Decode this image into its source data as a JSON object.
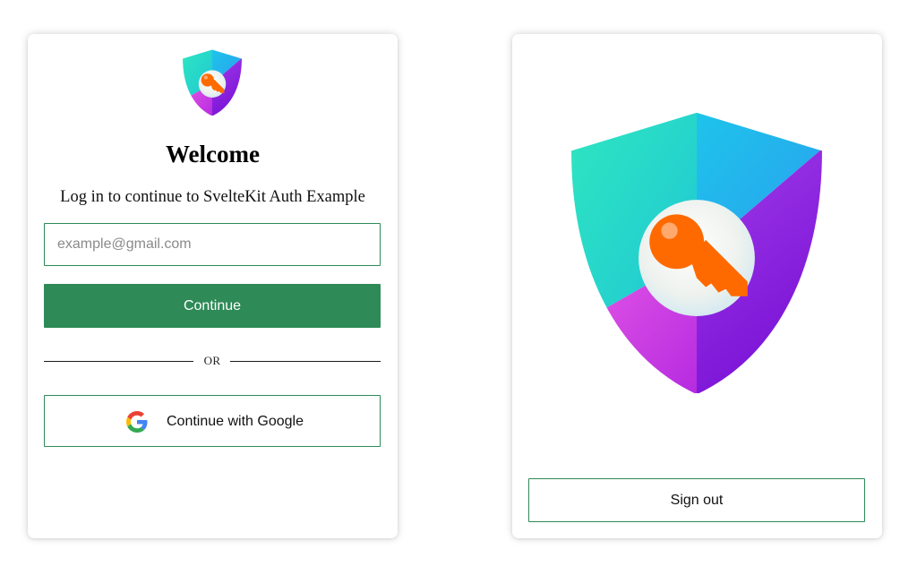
{
  "login": {
    "logo_icon": "shield-key-icon",
    "title": "Welcome",
    "subtitle": "Log in to continue to SvelteKit Auth Example",
    "email": {
      "value": "",
      "placeholder": "example@gmail.com"
    },
    "continue_label": "Continue",
    "divider_label": "OR",
    "google_icon": "google-icon",
    "google_label": "Continue with Google"
  },
  "session": {
    "logo_icon": "shield-key-icon",
    "signout_label": "Sign out"
  },
  "colors": {
    "accent": "#2e8a57",
    "shield_teal": "#2ee6c0",
    "shield_blue": "#1eb0ee",
    "shield_purple": "#8a22e0",
    "shield_magenta": "#d64ae6",
    "key_orange": "#ff6a00"
  }
}
